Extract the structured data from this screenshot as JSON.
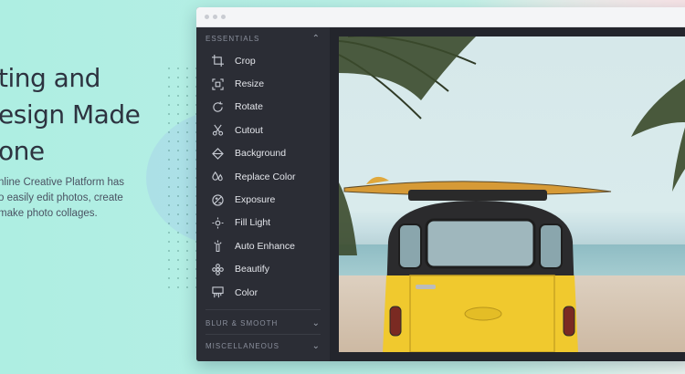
{
  "hero": {
    "title_lines": [
      "ting and",
      "esign Made",
      "one"
    ],
    "description_lines": [
      "nline Creative Platform has",
      "o easily edit photos, create",
      "make photo collages."
    ]
  },
  "sidebar": {
    "essentials_header": "ESSENTIALS",
    "tools": [
      {
        "label": "Crop",
        "icon": "crop-icon"
      },
      {
        "label": "Resize",
        "icon": "resize-icon"
      },
      {
        "label": "Rotate",
        "icon": "rotate-icon"
      },
      {
        "label": "Cutout",
        "icon": "scissors-icon"
      },
      {
        "label": "Background",
        "icon": "background-icon"
      },
      {
        "label": "Replace Color",
        "icon": "droplets-icon"
      },
      {
        "label": "Exposure",
        "icon": "exposure-icon"
      },
      {
        "label": "Fill Light",
        "icon": "sun-icon"
      },
      {
        "label": "Auto Enhance",
        "icon": "magic-wand-icon"
      },
      {
        "label": "Beautify",
        "icon": "flower-icon"
      },
      {
        "label": "Color",
        "icon": "color-palette-icon"
      }
    ],
    "collapsed_sections": [
      "BLUR & SMOOTH",
      "MISCELLANEOUS"
    ]
  },
  "colors": {
    "background": "#b6efe5",
    "window_dark": "#2c2f37",
    "van_yellow": "#f0c92e"
  }
}
